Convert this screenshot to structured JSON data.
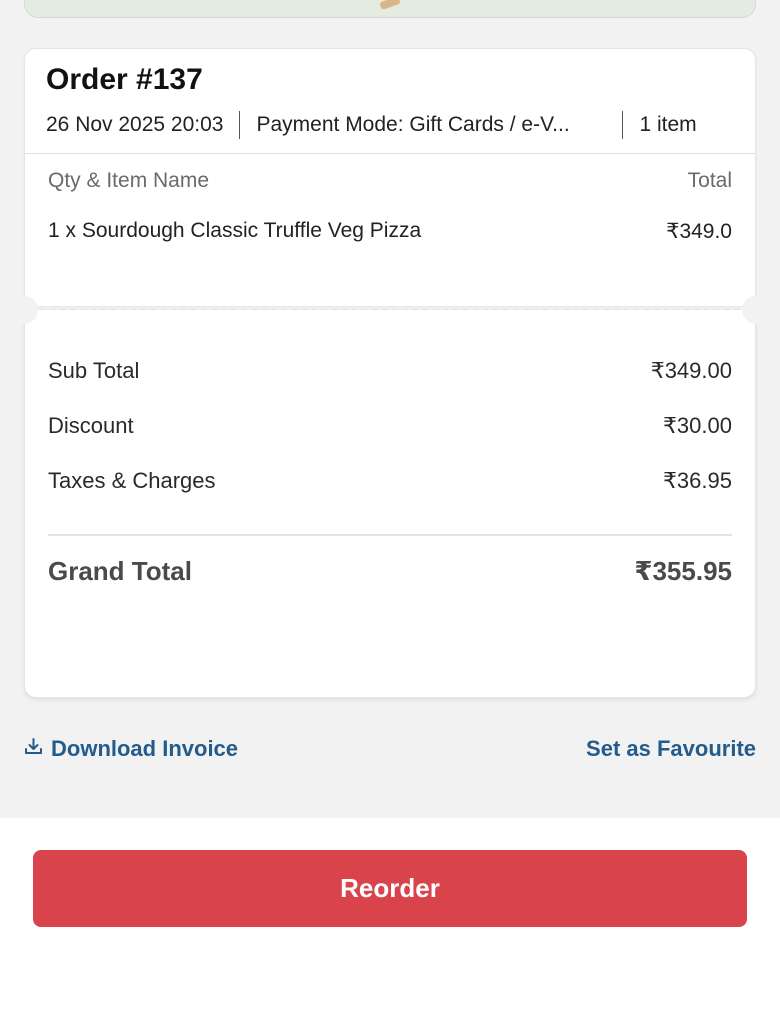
{
  "order": {
    "title": "Order #137",
    "datetime": "26 Nov 2025 20:03",
    "payment": "Payment Mode: Gift Cards / e-V...",
    "item_count": "1 item"
  },
  "items": {
    "header_left": "Qty & Item Name",
    "header_right": "Total",
    "rows": [
      {
        "name": "1 x Sourdough Classic Truffle Veg Pizza",
        "total": "₹349.0"
      }
    ]
  },
  "summary": {
    "rows": [
      {
        "label": "Sub Total",
        "value": "₹349.00"
      },
      {
        "label": "Discount",
        "value": "₹30.00"
      },
      {
        "label": "Taxes & Charges",
        "value": "₹36.95"
      }
    ],
    "grand_label": "Grand Total",
    "grand_value": "₹355.95"
  },
  "actions": {
    "download_label": "Download Invoice",
    "favourite_label": "Set as Favourite"
  },
  "footer": {
    "reorder_label": "Reorder"
  },
  "colors": {
    "accent": "#d9434c",
    "link": "#235c8c"
  },
  "icons": {
    "download": "download-icon"
  }
}
